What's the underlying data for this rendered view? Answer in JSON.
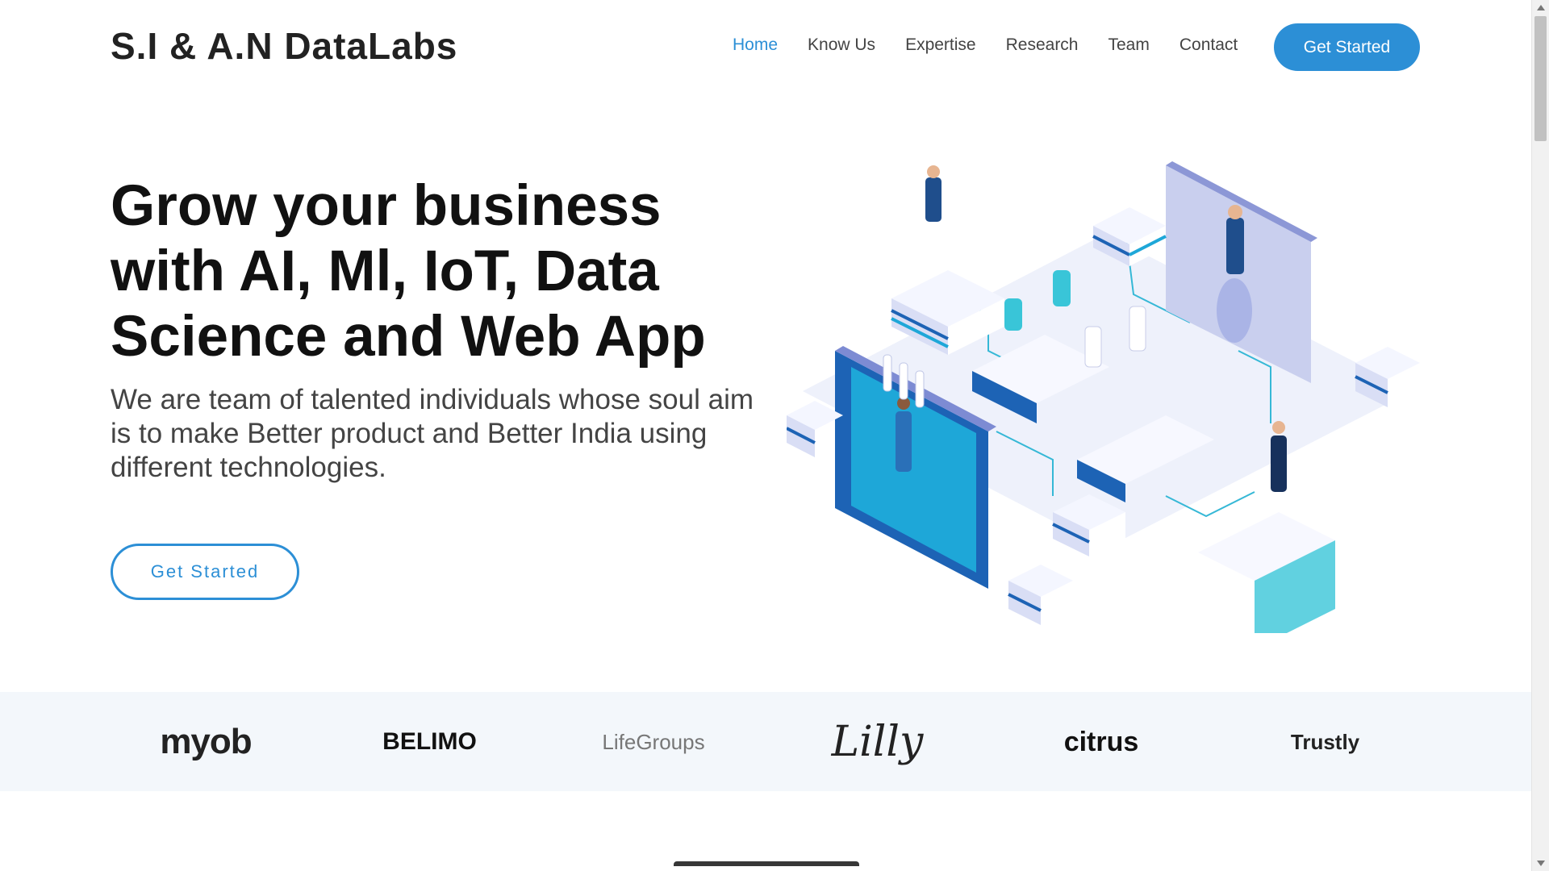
{
  "header": {
    "logo": "S.I & A.N DataLabs",
    "nav": [
      "Home",
      "Know Us",
      "Expertise",
      "Research",
      "Team",
      "Contact"
    ],
    "cta": "Get Started"
  },
  "hero": {
    "title": "Grow your business with AI, Ml, IoT, Data Science and Web App",
    "subtitle": "We are team of talented individuals whose soul aim is to make Better product and Better India using different technologies.",
    "cta": "Get Started"
  },
  "clients": [
    "myob",
    "BELIMO",
    "LifeGroups",
    "Lilly",
    "citrus",
    "Trustly"
  ],
  "colors": {
    "accent": "#2c8fd6",
    "strip": "#f3f7fb"
  }
}
